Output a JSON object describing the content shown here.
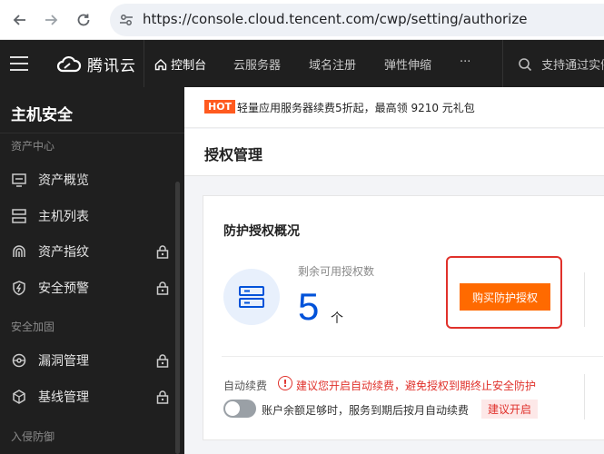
{
  "browser": {
    "url": "https://console.cloud.tencent.com/cwp/setting/authorize"
  },
  "topnav": {
    "logo_text": "腾讯云",
    "items": [
      {
        "label": "控制台",
        "icon": "home-icon"
      },
      {
        "label": "云服务器"
      },
      {
        "label": "域名注册"
      },
      {
        "label": "弹性伸缩"
      },
      {
        "label": "···"
      }
    ],
    "search_placeholder": "支持通过实例"
  },
  "sidebar": {
    "title": "主机安全",
    "sections": [
      {
        "label": "资产中心"
      },
      {
        "label": "安全加固"
      },
      {
        "label": "入侵防御"
      }
    ],
    "items": [
      {
        "label": "资产概览",
        "icon": "monitor-icon",
        "locked": false
      },
      {
        "label": "主机列表",
        "icon": "list-icon",
        "locked": false
      },
      {
        "label": "资产指纹",
        "icon": "fingerprint-icon",
        "locked": true
      },
      {
        "label": "安全预警",
        "icon": "shield-icon",
        "locked": true
      },
      {
        "label": "漏洞管理",
        "icon": "bug-icon",
        "locked": true
      },
      {
        "label": "基线管理",
        "icon": "cube-icon",
        "locked": true
      }
    ]
  },
  "promo": {
    "badge": "HOT",
    "text": "轻量应用服务器续费5折起，最高领 9210 元礼包"
  },
  "page": {
    "title": "授权管理"
  },
  "card": {
    "title": "防护授权概况",
    "remain_label": "剩余可用授权数",
    "remain_count": "5",
    "remain_unit": "个",
    "buy_button": "购买防护授权",
    "renew_label": "自动续费",
    "warn_icon": "!",
    "warn_text": "建议您开启自动续费，避免授权到期终止安全防护",
    "toggle_text": "账户余额足够时，服务到期后按月自动续费",
    "toggle_on": false,
    "suggest_tag": "建议开启"
  },
  "colors": {
    "accent_blue": "#0052d9",
    "buy_orange": "#ff6a00",
    "warn_red": "#e0312b",
    "hot_orange": "#ff5a1f",
    "nav_dark": "#1f1f1f"
  }
}
